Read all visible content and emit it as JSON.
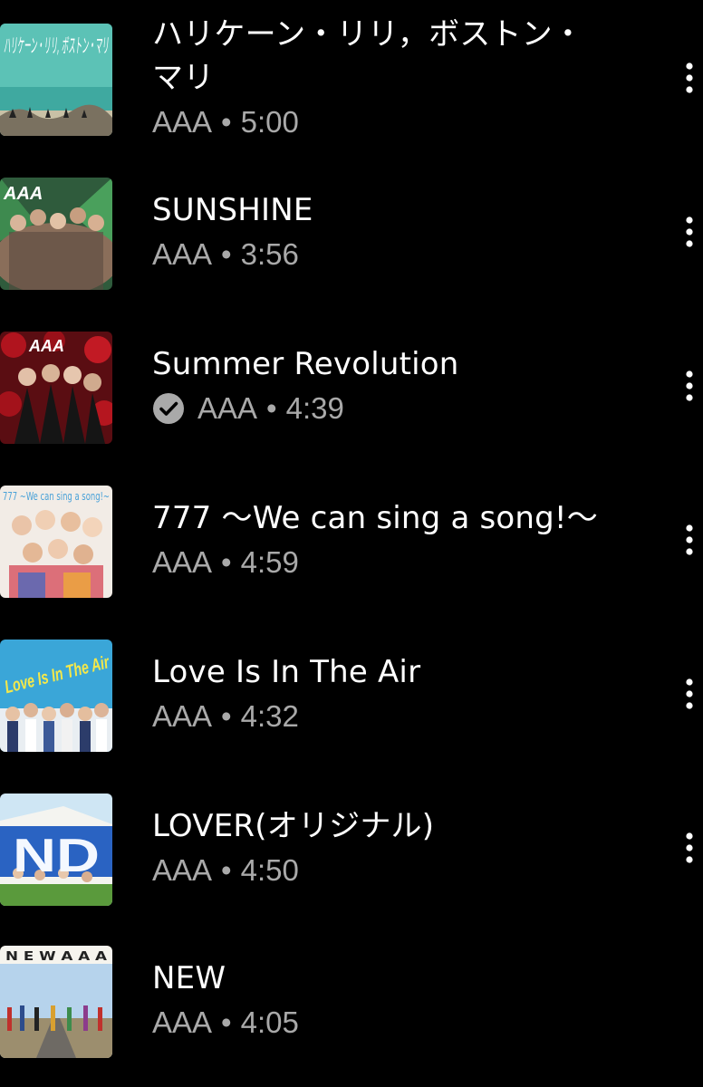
{
  "tracks": [
    {
      "title_line1": "ハリケーン・リリ，ボストン・",
      "title_line2": "マリ",
      "artist": "AAA",
      "separator": "•",
      "duration": "5:00",
      "verified": false,
      "art": "teal-beach",
      "art_text": "ハリケーン・リリ, ボストン・マリ"
    },
    {
      "title": "SUNSHINE",
      "artist": "AAA",
      "separator": "•",
      "duration": "3:56",
      "verified": false,
      "art": "jungle-group",
      "art_text": "AAA"
    },
    {
      "title": "Summer Revolution",
      "artist": "AAA",
      "separator": "•",
      "duration": "4:39",
      "verified": true,
      "art": "red-roses",
      "art_text": "AAA"
    },
    {
      "title": "777 〜We can sing a song!〜",
      "artist": "AAA",
      "separator": "•",
      "duration": "4:59",
      "verified": false,
      "art": "white-group",
      "art_text": "777 ~We can sing a song!~"
    },
    {
      "title": "Love Is In The Air",
      "artist": "AAA",
      "separator": "•",
      "duration": "4:32",
      "verified": false,
      "art": "sky-blue",
      "art_text": "Love Is In The Air"
    },
    {
      "title": "LOVER(オリジナル)",
      "artist": "AAA",
      "separator": "•",
      "duration": "4:50",
      "verified": false,
      "art": "blue-house",
      "art_text": "ND"
    },
    {
      "title": "NEW",
      "artist": "AAA",
      "separator": "•",
      "duration": "4:05",
      "verified": false,
      "art": "road-sky",
      "art_text": "N E W   A A A"
    }
  ],
  "colors": {
    "background": "#000000",
    "title": "#ffffff",
    "subtitle": "#a9a9a9"
  },
  "icons": {
    "more": "more-vert-icon",
    "verified": "check-circle-icon"
  }
}
